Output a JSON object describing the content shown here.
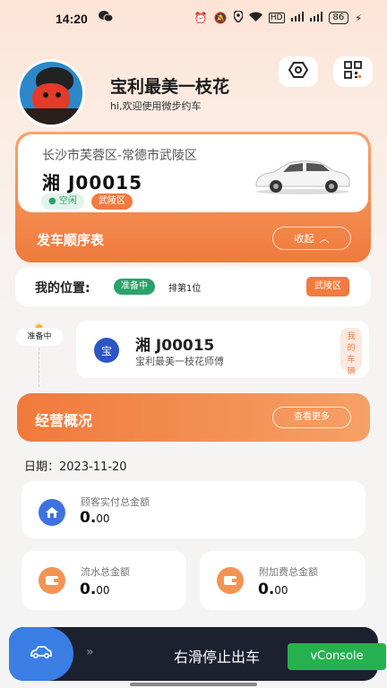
{
  "status": {
    "time": "14:20",
    "battery": "86"
  },
  "profile": {
    "name": "宝利最美一枝花",
    "welcome": "hi,欢迎使用微步约车"
  },
  "car_card": {
    "route": "长沙市芙蓉区-常德市武陵区",
    "plate": "湘 J00015",
    "status_tag": "空闲",
    "area_tag": "武陵区",
    "dispatch_title": "发车顺序表",
    "collapse_label": "收起"
  },
  "position": {
    "label": "我的位置:",
    "state": "准备中",
    "rank": "排第1位",
    "area": "武陵区"
  },
  "queue": {
    "timeline_label": "准备中",
    "avatar_char": "宝",
    "plate": "湘 J00015",
    "driver": "宝利最美一枝花师傅",
    "mine_label": "我的车辆"
  },
  "overview": {
    "title": "经营概况",
    "more_label": "查看更多"
  },
  "date_line": "日期：2023-11-20",
  "stats": {
    "customer_paid": {
      "label": "顾客实付总金额",
      "int": "0.",
      "dec": "00"
    },
    "turnover": {
      "label": "流水总金额",
      "int": "0.",
      "dec": "00"
    },
    "surcharge": {
      "label": "附加费总金额",
      "int": "0.",
      "dec": "00"
    }
  },
  "bottom": {
    "chevrons": "»",
    "slide_label": "右滑停止出车"
  },
  "vconsole": "vConsole",
  "colors": {
    "accent": "#f27b3f",
    "green": "#2aa36b",
    "blue": "#2b56c6",
    "bar": "#1c2130"
  }
}
